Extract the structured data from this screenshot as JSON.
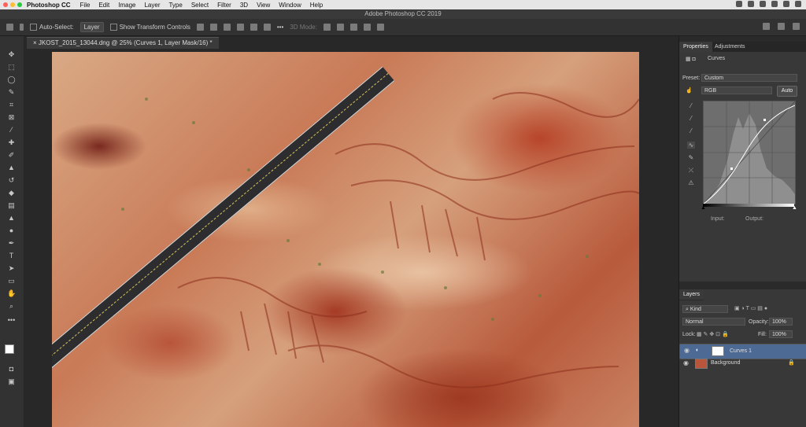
{
  "menubar": {
    "app": "Photoshop CC",
    "items": [
      "File",
      "Edit",
      "Image",
      "Layer",
      "Type",
      "Select",
      "Filter",
      "3D",
      "View",
      "Window",
      "Help"
    ]
  },
  "window_title": "Adobe Photoshop CC 2019",
  "options": {
    "auto_select_label": "Auto-Select:",
    "auto_select_value": "Layer",
    "show_transform_label": "Show Transform Controls",
    "mode_3d_label": "3D Mode:"
  },
  "doc_tab": "JKOST_2015_13044.dng @ 25% (Curves 1, Layer Mask/16) *",
  "properties": {
    "tab_properties": "Properties",
    "tab_adjustments": "Adjustments",
    "adjust_name": "Curves",
    "preset_label": "Preset:",
    "preset_value": "Custom",
    "channel_value": "RGB",
    "auto_label": "Auto",
    "input_label": "Input:",
    "output_label": "Output:"
  },
  "layers": {
    "tab_label": "Layers",
    "filter_value": "Kind",
    "blend_mode": "Normal",
    "opacity_label": "Opacity:",
    "opacity_value": "100%",
    "lock_label": "Lock:",
    "fill_label": "Fill:",
    "fill_value": "100%",
    "items": [
      {
        "name": "Curves 1",
        "selected": true
      },
      {
        "name": "Background",
        "selected": false
      }
    ]
  },
  "colors": {
    "accent": "#4d6a95",
    "rock_red": "#b8452a",
    "rock_pale": "#e8c2a2"
  }
}
